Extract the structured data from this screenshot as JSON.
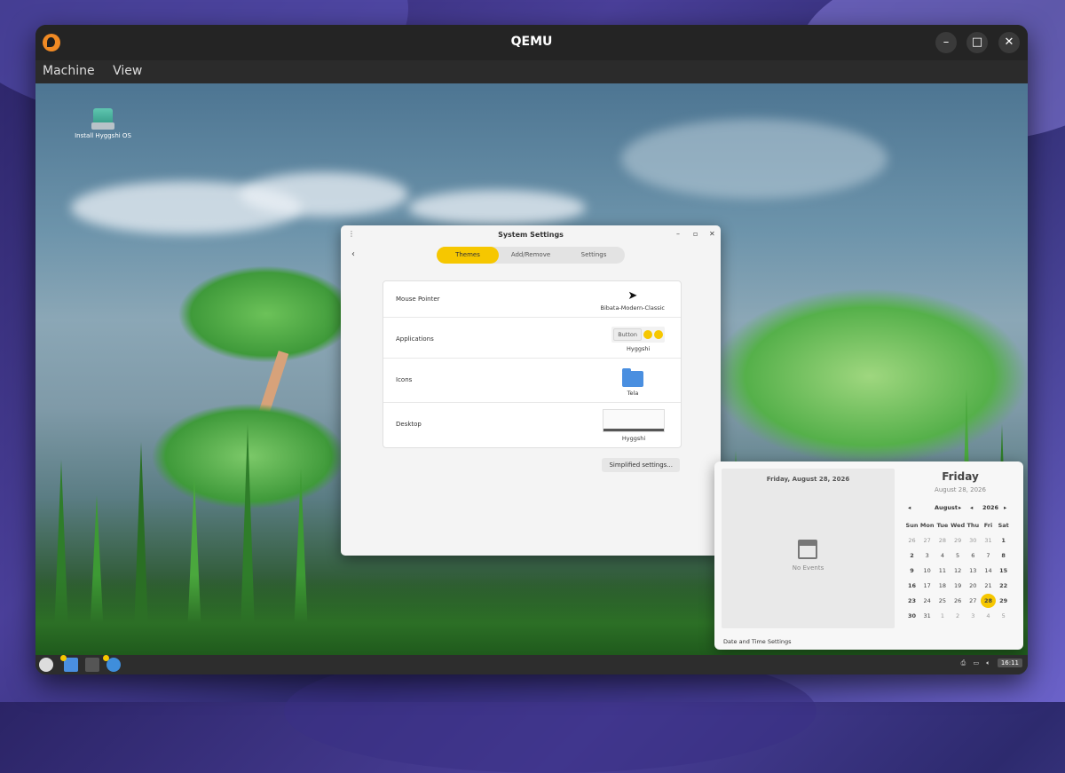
{
  "qemu": {
    "title": "QEMU",
    "menu": [
      "Machine",
      "View"
    ],
    "controls": {
      "minimize": "–",
      "maximize": "□",
      "close": "✕"
    }
  },
  "desktop": {
    "install_icon_label": "Install Hyggshi OS"
  },
  "settings": {
    "title": "System Settings",
    "tabs": {
      "themes": "Themes",
      "add_remove": "Add/Remove",
      "settings": "Settings"
    },
    "rows": {
      "mouse_pointer": {
        "label": "Mouse Pointer",
        "value": "Bibata-Modern-Classic"
      },
      "applications": {
        "label": "Applications",
        "value": "Hyggshi",
        "preview_button": "Button"
      },
      "icons": {
        "label": "Icons",
        "value": "Tela"
      },
      "desktop": {
        "label": "Desktop",
        "value": "Hyggshi"
      }
    },
    "simplified_button": "Simplified settings..."
  },
  "calendar": {
    "events_date": "Friday, August 28, 2026",
    "no_events": "No Events",
    "date_time_settings": "Date and Time Settings",
    "day": "Friday",
    "date": "August 28, 2026",
    "month": "August",
    "year": "2026",
    "weekdays": [
      "Sun",
      "Mon",
      "Tue",
      "Wed",
      "Thu",
      "Fri",
      "Sat"
    ],
    "weeks": [
      [
        "26",
        "27",
        "28",
        "29",
        "30",
        "31",
        "1"
      ],
      [
        "2",
        "3",
        "4",
        "5",
        "6",
        "7",
        "8"
      ],
      [
        "9",
        "10",
        "11",
        "12",
        "13",
        "14",
        "15"
      ],
      [
        "16",
        "17",
        "18",
        "19",
        "20",
        "21",
        "22"
      ],
      [
        "23",
        "24",
        "25",
        "26",
        "27",
        "28",
        "29"
      ],
      [
        "30",
        "31",
        "1",
        "2",
        "3",
        "4",
        "5"
      ]
    ],
    "today": "28"
  },
  "taskbar": {
    "clock": "16:11",
    "tray_icons": [
      "printer-icon",
      "display-icon",
      "volume-icon"
    ]
  },
  "colors": {
    "accent": "#f6c700"
  }
}
